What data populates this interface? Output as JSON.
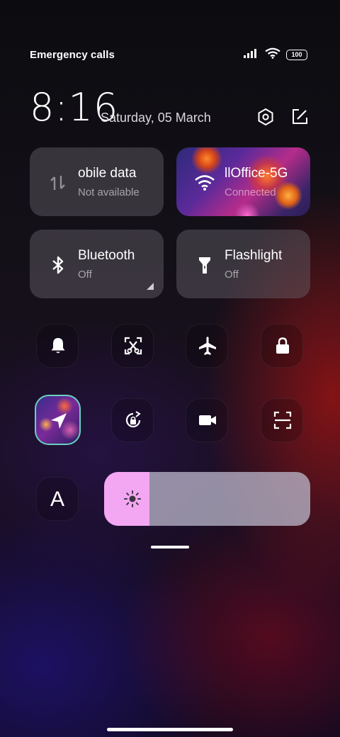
{
  "status": {
    "carrier": "Emergency calls o",
    "battery": "100",
    "icons": [
      "signal-icon",
      "wifi-icon",
      "battery-icon"
    ]
  },
  "header": {
    "time": "8:16",
    "date": "Saturday, 05 March",
    "icons": [
      "settings-icon",
      "edit-icon"
    ]
  },
  "tiles": {
    "mobile": {
      "title": "obile data",
      "subtitle": "Not available",
      "icon": "mobile-data-icon"
    },
    "wifi": {
      "title": "llOffice-5G",
      "subtitle": "Connected",
      "icon": "wifi-icon"
    },
    "bluetooth": {
      "title": "Bluetooth",
      "subtitle": "Off",
      "icon": "bluetooth-icon"
    },
    "flashlight": {
      "title": "Flashlight",
      "subtitle": "Off",
      "icon": "flashlight-icon"
    }
  },
  "toggles": [
    "bell-icon",
    "screenshot-icon",
    "airplane-icon",
    "lock-icon",
    "location-icon",
    "rotation-lock-icon",
    "video-camera-icon",
    "scan-icon",
    "font-icon"
  ],
  "font_toggle": {
    "label": "A"
  },
  "brightness": {
    "level": 0.22,
    "icon": "sun-icon",
    "fill_color": "#f3a6f2"
  }
}
